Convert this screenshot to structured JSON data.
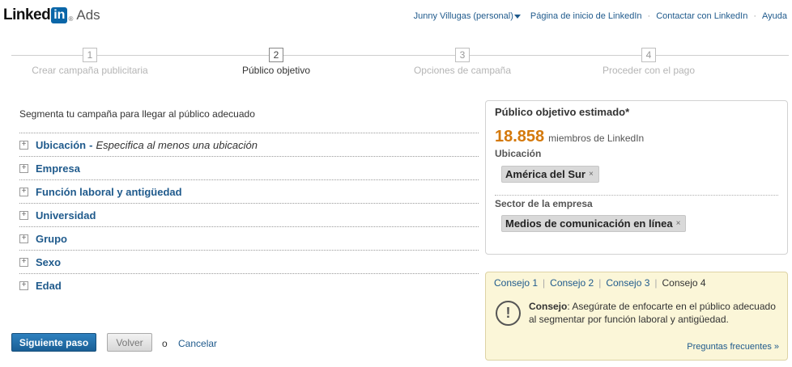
{
  "header": {
    "logo_word": "Linked",
    "logo_in": "in",
    "logo_reg": "®",
    "product": "Ads",
    "user": "Junny Villugas (personal)",
    "links": [
      "Página de inicio de LinkedIn",
      "Contactar con LinkedIn",
      "Ayuda"
    ],
    "separator": "·"
  },
  "steps": [
    {
      "number": "1",
      "label": "Crear campaña publicitaria",
      "active": false
    },
    {
      "number": "2",
      "label": "Público objetivo",
      "active": true
    },
    {
      "number": "3",
      "label": "Opciones de campaña",
      "active": false
    },
    {
      "number": "4",
      "label": "Proceder con el pago",
      "active": false
    }
  ],
  "segment": {
    "intro": "Segmenta tu campaña para llegar al público adecuado",
    "expand_symbol": "+",
    "items": [
      {
        "label": "Ubicación",
        "dash": "-",
        "hint": "Especifica al menos una ubicación"
      },
      {
        "label": "Empresa"
      },
      {
        "label": "Función laboral y antigüedad"
      },
      {
        "label": "Universidad"
      },
      {
        "label": "Grupo"
      },
      {
        "label": "Sexo"
      },
      {
        "label": "Edad"
      }
    ]
  },
  "buttons": {
    "next": "Siguiente paso",
    "back": "Volver",
    "or": "o",
    "cancel": "Cancelar"
  },
  "audience": {
    "title": "Público objetivo estimado*",
    "count": "18.858",
    "count_unit": "miembros de LinkedIn",
    "location_label": "Ubicación",
    "location_tag": "América del Sur",
    "industry_label": "Sector de la empresa",
    "industry_tag": "Medios de comunicación en línea",
    "remove_symbol": "×"
  },
  "tips": {
    "tabs": [
      "Consejo 1",
      "Consejo 2",
      "Consejo 3",
      "Consejo 4"
    ],
    "current_tab": 3,
    "separator": "|",
    "icon_symbol": "!",
    "label": "Consejo",
    "text": ": Asegúrate de enfocarte en el público adecuado al segmentar por función laboral y antigüedad.",
    "faq": "Preguntas frecuentes »"
  },
  "colors": {
    "link": "#1f5a8c",
    "accent_count": "#d4790c",
    "primary_button": "#1a5f95",
    "tips_background": "#fbf6d8"
  }
}
